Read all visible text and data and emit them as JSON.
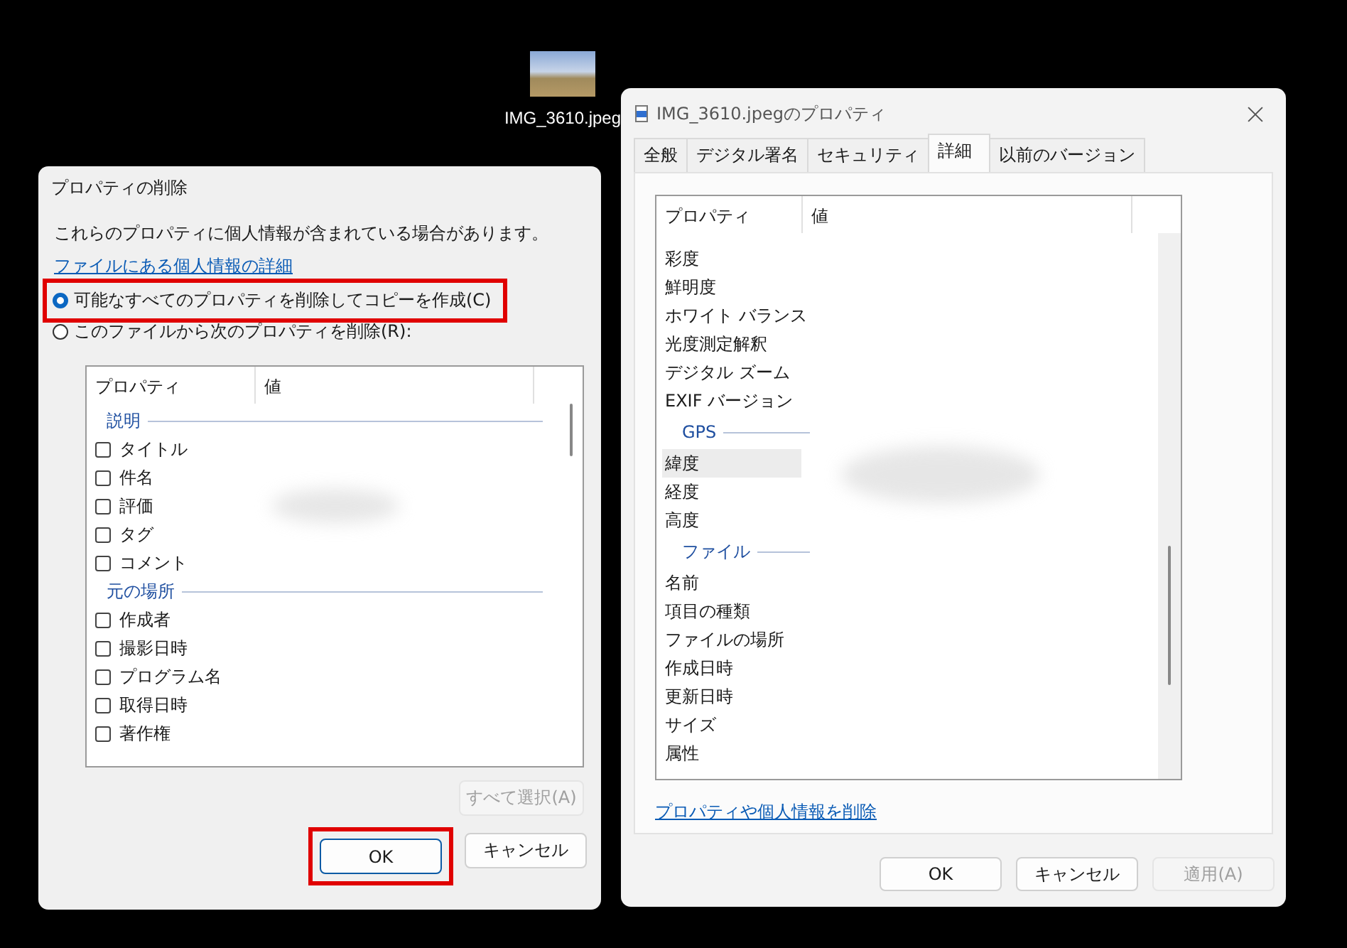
{
  "desktop_icon": {
    "label": "IMG_3610.jpeg"
  },
  "remove_dialog": {
    "title": "プロパティの削除",
    "intro": "これらのプロパティに個人情報が含まれている場合があります。",
    "link": "ファイルにある個人情報の詳細",
    "options": [
      {
        "label": "可能なすべてのプロパティを削除してコピーを作成(C)",
        "selected": true,
        "highlighted": true
      },
      {
        "label": "このファイルから次のプロパティを削除(R):",
        "selected": false,
        "highlighted": false
      }
    ],
    "list": {
      "columns": [
        "プロパティ",
        "値"
      ],
      "groups": [
        {
          "name": "説明",
          "items": [
            {
              "label": "タイトル",
              "checked": false
            },
            {
              "label": "件名",
              "checked": false
            },
            {
              "label": "評価",
              "checked": false
            },
            {
              "label": "タグ",
              "checked": false
            },
            {
              "label": "コメント",
              "checked": false
            }
          ]
        },
        {
          "name": "元の場所",
          "items": [
            {
              "label": "作成者",
              "checked": false
            },
            {
              "label": "撮影日時",
              "checked": false
            },
            {
              "label": "プログラム名",
              "checked": false
            },
            {
              "label": "取得日時",
              "checked": false
            },
            {
              "label": "著作権",
              "checked": false
            }
          ]
        }
      ]
    },
    "select_all_button": {
      "label": "すべて選択(A)",
      "disabled": true
    },
    "buttons": [
      {
        "label": "OK",
        "default": true,
        "highlighted": true
      },
      {
        "label": "キャンセル",
        "default": false,
        "highlighted": false
      }
    ]
  },
  "properties_dialog": {
    "title": "IMG_3610.jpegのプロパティ",
    "tabs": [
      {
        "label": "全般",
        "selected": false
      },
      {
        "label": "デジタル署名",
        "selected": false
      },
      {
        "label": "セキュリティ",
        "selected": false
      },
      {
        "label": "詳細",
        "selected": true
      },
      {
        "label": "以前のバージョン",
        "selected": false
      }
    ],
    "columns": [
      "プロパティ",
      "値"
    ],
    "rows": [
      {
        "kind": "row",
        "label": "彩度",
        "selected": false
      },
      {
        "kind": "row",
        "label": "鮮明度",
        "selected": false
      },
      {
        "kind": "row",
        "label": "ホワイト バランス",
        "selected": false
      },
      {
        "kind": "row",
        "label": "光度測定解釈",
        "selected": false
      },
      {
        "kind": "row",
        "label": "デジタル ズーム",
        "selected": false
      },
      {
        "kind": "row",
        "label": "EXIF バージョン",
        "selected": false
      },
      {
        "kind": "group",
        "label": "GPS"
      },
      {
        "kind": "row",
        "label": "緯度",
        "selected": true
      },
      {
        "kind": "row",
        "label": "経度",
        "selected": false
      },
      {
        "kind": "row",
        "label": "高度",
        "selected": false
      },
      {
        "kind": "group",
        "label": "ファイル"
      },
      {
        "kind": "row",
        "label": "名前",
        "selected": false
      },
      {
        "kind": "row",
        "label": "項目の種類",
        "selected": false
      },
      {
        "kind": "row",
        "label": "ファイルの場所",
        "selected": false
      },
      {
        "kind": "row",
        "label": "作成日時",
        "selected": false
      },
      {
        "kind": "row",
        "label": "更新日時",
        "selected": false
      },
      {
        "kind": "row",
        "label": "サイズ",
        "selected": false
      },
      {
        "kind": "row",
        "label": "属性",
        "selected": false
      }
    ],
    "link": "プロパティや個人情報を削除",
    "buttons": [
      {
        "label": "OK",
        "disabled": false
      },
      {
        "label": "キャンセル",
        "disabled": false
      },
      {
        "label": "適用(A)",
        "disabled": true
      }
    ]
  }
}
